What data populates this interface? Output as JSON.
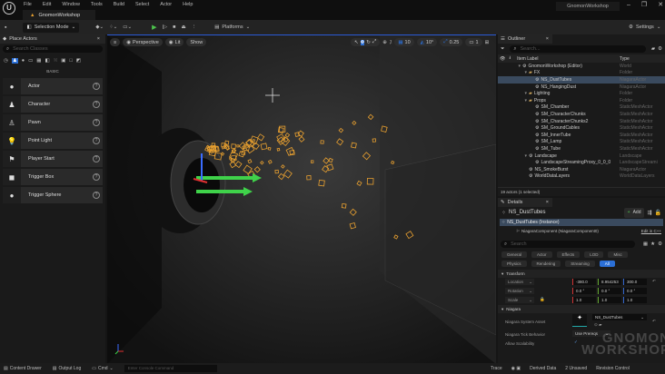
{
  "app": {
    "project_name": "GnomonWorkshop",
    "doc_tab": "GnomonWorkshop",
    "logo": "UE"
  },
  "menu": [
    "File",
    "Edit",
    "Window",
    "Tools",
    "Build",
    "Select",
    "Actor",
    "Help"
  ],
  "toolbar": {
    "selection_mode": "Selection Mode",
    "platforms": "Platforms",
    "settings": "Settings"
  },
  "place_actors": {
    "title": "Place Actors",
    "search_placeholder": "Search Classes",
    "category": "BASIC",
    "items": [
      {
        "label": "Actor",
        "icon": "cube-icon"
      },
      {
        "label": "Character",
        "icon": "person-icon"
      },
      {
        "label": "Pawn",
        "icon": "pawn-icon"
      },
      {
        "label": "Point Light",
        "icon": "lightbulb-icon"
      },
      {
        "label": "Player Start",
        "icon": "flag-icon"
      },
      {
        "label": "Trigger Box",
        "icon": "box-icon"
      },
      {
        "label": "Trigger Sphere",
        "icon": "sphere-icon"
      }
    ]
  },
  "viewport": {
    "perspective": "Perspective",
    "lit": "Lit",
    "show": "Show",
    "grid_snap": "10",
    "rot_snap": "10°",
    "scale_snap": "0.25",
    "camera_speed": "1"
  },
  "outliner": {
    "title": "Outliner",
    "search_placeholder": "Search...",
    "col_label": "Item Label",
    "col_type": "Type",
    "rows": [
      {
        "label": "GnomonWorkshop (Editor)",
        "type": "World",
        "indent": 1
      },
      {
        "label": "FX",
        "type": "Folder",
        "indent": 2
      },
      {
        "label": "NS_DustTubes",
        "type": "NiagaraActor",
        "indent": 3,
        "selected": true
      },
      {
        "label": "NS_HangingDust",
        "type": "NiagaraActor",
        "indent": 3
      },
      {
        "label": "Lighting",
        "type": "Folder",
        "indent": 2
      },
      {
        "label": "Props",
        "type": "Folder",
        "indent": 2
      },
      {
        "label": "SM_Chamber",
        "type": "StaticMeshActor",
        "indent": 3
      },
      {
        "label": "SM_CharacterChunks",
        "type": "StaticMeshActor",
        "indent": 3
      },
      {
        "label": "SM_CharacterChunks2",
        "type": "StaticMeshActor",
        "indent": 3
      },
      {
        "label": "SM_GroundCables",
        "type": "StaticMeshActor",
        "indent": 3
      },
      {
        "label": "SM_InnerTube",
        "type": "StaticMeshActor",
        "indent": 3
      },
      {
        "label": "SM_Lamp",
        "type": "StaticMeshActor",
        "indent": 3
      },
      {
        "label": "SM_Tube",
        "type": "StaticMeshActor",
        "indent": 3
      },
      {
        "label": "Landscape",
        "type": "Landscape",
        "indent": 2
      },
      {
        "label": "LandscapeStreamingProxy_0_0_0",
        "type": "LandscapeStreami",
        "indent": 3
      },
      {
        "label": "NS_SmokeBurst",
        "type": "NiagaraActor",
        "indent": 2
      },
      {
        "label": "WorldDataLayers",
        "type": "WorldDataLayers",
        "indent": 2
      }
    ],
    "footer": "19 actors (1 selected)"
  },
  "details": {
    "title": "Details",
    "actor": "NS_DustTubes",
    "add": "Add",
    "instance": "NS_DustTubes (Instance)",
    "component": "NiagaraComponent (NiagaraComponent0)",
    "edit_cpp": "Edit in C++",
    "search_placeholder": "Search",
    "filters": [
      "General",
      "Actor",
      "Effects",
      "LOD",
      "Misc",
      "Physics",
      "Rendering",
      "Streaming",
      "All"
    ],
    "active_filter": "All",
    "transform": {
      "title": "Transform",
      "location": {
        "label": "Location",
        "x": "-380.0",
        "y": "8.954253",
        "z": "300.0"
      },
      "rotation": {
        "label": "Rotation",
        "x": "0.0 °",
        "y": "0.0 °",
        "z": "0.0 °"
      },
      "scale": {
        "label": "Scale",
        "x": "1.0",
        "y": "1.0",
        "z": "1.0"
      }
    },
    "niagara": {
      "title": "Niagara",
      "system_asset_label": "Niagara System Asset",
      "system_asset": "NS_DustTubes",
      "tick_label": "Niagara Tick Behavior",
      "tick_value": "Use Prereqs",
      "scalability_label": "Allow Scalability",
      "scalability": true
    }
  },
  "statusbar": {
    "content_drawer": "Content Drawer",
    "output_log": "Output Log",
    "cmd": "Cmd",
    "console_placeholder": "Enter Console Command",
    "trace": "Trace",
    "derived_data": "Derived Data",
    "unsaved": "2 Unsaved",
    "revision_control": "Revision Control"
  },
  "watermark": "GNOMON WORKSHOP",
  "colors": {
    "accent": "#2b6fd6",
    "particle": "#e8a030",
    "gizmo": "#3fd24a",
    "play": "#4cc34c"
  }
}
